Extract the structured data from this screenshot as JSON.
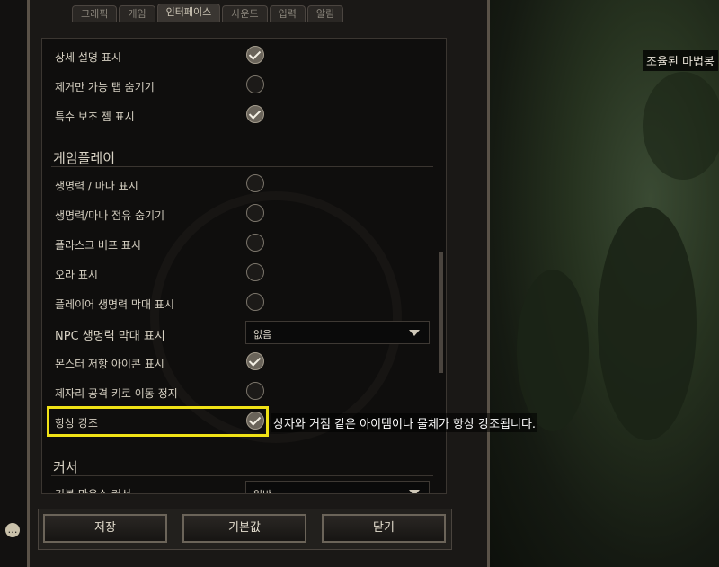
{
  "tabs": [
    "그래픽",
    "게임",
    "인터페이스",
    "사운드",
    "입력",
    "알림"
  ],
  "active_tab": "인터페이스",
  "world_label": "조율된 마법봉",
  "rows": [
    {
      "label": "상세 설명 표시",
      "checked": true
    },
    {
      "label": "제거만 가능 탭 숨기기",
      "checked": false
    },
    {
      "label": "특수 보조 젬 표시",
      "checked": true
    }
  ],
  "section_gameplay": "게임플레이",
  "gameplay_rows": [
    {
      "label": "생명력 / 마나 표시",
      "checked": false
    },
    {
      "label": "생명력/마나 점유 숨기기",
      "checked": false
    },
    {
      "label": "플라스크 버프 표시",
      "checked": false
    },
    {
      "label": "오라 표시",
      "checked": false
    },
    {
      "label": "플레이어 생명력 막대 표시",
      "checked": false
    }
  ],
  "npc_row": {
    "label": "NPC 생명력 막대 표시",
    "value": "없음"
  },
  "gameplay_rows2": [
    {
      "label": "몬스터 저항 아이콘 표시",
      "checked": true
    },
    {
      "label": "제자리 공격 키로 이동 정지",
      "checked": false
    },
    {
      "label": "항상 강조",
      "checked": true
    }
  ],
  "tooltip": "상자와 거점 같은 아이템이나 물체가 항상 강조됩니다.",
  "section_cursor": "커서",
  "cursor_row": {
    "label": "기본 마우스 커서",
    "value": "일반"
  },
  "buttons": {
    "save": "저장",
    "default": "기본값",
    "close": "닫기"
  }
}
